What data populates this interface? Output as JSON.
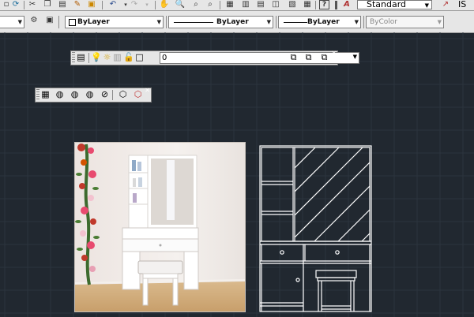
{
  "toolbar": {
    "style_combo": {
      "value": "Standard"
    },
    "right_partial_label": "IS"
  },
  "properties": {
    "color": "ByLayer",
    "linetype": "ByLayer",
    "lineweight": "ByLayer",
    "plotstyle": "ByColor"
  },
  "layers": {
    "current_layer": "0"
  },
  "colors": {
    "canvas": "#212830",
    "grid": "#2c343e",
    "toolbar_bg": "#e6e6e6",
    "drawing_lines": "#ffffff"
  },
  "icons": {
    "toolbar": [
      "cut-icon",
      "copy-icon",
      "paste-icon",
      "match-properties-icon",
      "undo-icon",
      "redo-icon",
      "pan-icon",
      "zoom-realtime-icon",
      "zoom-window-icon",
      "zoom-previous-icon",
      "properties-icon",
      "design-center-icon",
      "tool-palettes-icon",
      "sheet-set-icon",
      "calculator-icon",
      "help-icon",
      "text-style-icon"
    ],
    "layer_bar": [
      "layer-manager-icon",
      "layer-on-icon",
      "freeze-icon",
      "lock-icon",
      "color-swatch-icon",
      "make-current-icon",
      "layer-previous-icon",
      "layer-states-icon"
    ],
    "view_bar": [
      "3d-view-icon",
      "orbit-icon",
      "constrained-orbit-icon",
      "free-orbit-icon",
      "continuous-orbit-icon",
      "top-view-icon",
      "walk-icon"
    ]
  }
}
